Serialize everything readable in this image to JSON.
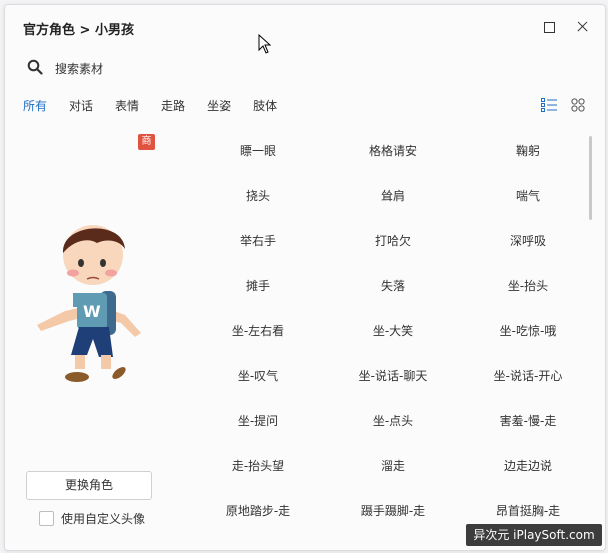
{
  "breadcrumb": "官方角色 > 小男孩",
  "search": {
    "placeholder": "搜索素材"
  },
  "tabs": [
    {
      "label": "所有",
      "active": true
    },
    {
      "label": "对话",
      "active": false
    },
    {
      "label": "表情",
      "active": false
    },
    {
      "label": "走路",
      "active": false
    },
    {
      "label": "坐姿",
      "active": false
    },
    {
      "label": "肢体",
      "active": false
    }
  ],
  "badge": "商",
  "change_button": "更换角色",
  "custom_avatar_label": "使用自定义头像",
  "custom_avatar_checked": false,
  "actions": [
    "瞟一眼",
    "格格请安",
    "鞠躬",
    "挠头",
    "耸肩",
    "喘气",
    "举右手",
    "打哈欠",
    "深呼吸",
    "摊手",
    "失落",
    "坐-抬头",
    "坐-左右看",
    "坐-大笑",
    "坐-吃惊-哦",
    "坐-叹气",
    "坐-说话-聊天",
    "坐-说话-开心",
    "坐-提问",
    "坐-点头",
    "害羞-慢-走",
    "走-抬头望",
    "溜走",
    "边走边说",
    "原地踏步-走",
    "蹑手蹑脚-走",
    "昂首挺胸-走"
  ],
  "character_letter": "W",
  "watermark": "异次元 iPlaySoft.com",
  "colors": {
    "accent": "#1f6fc4",
    "badge": "#e0533f"
  }
}
